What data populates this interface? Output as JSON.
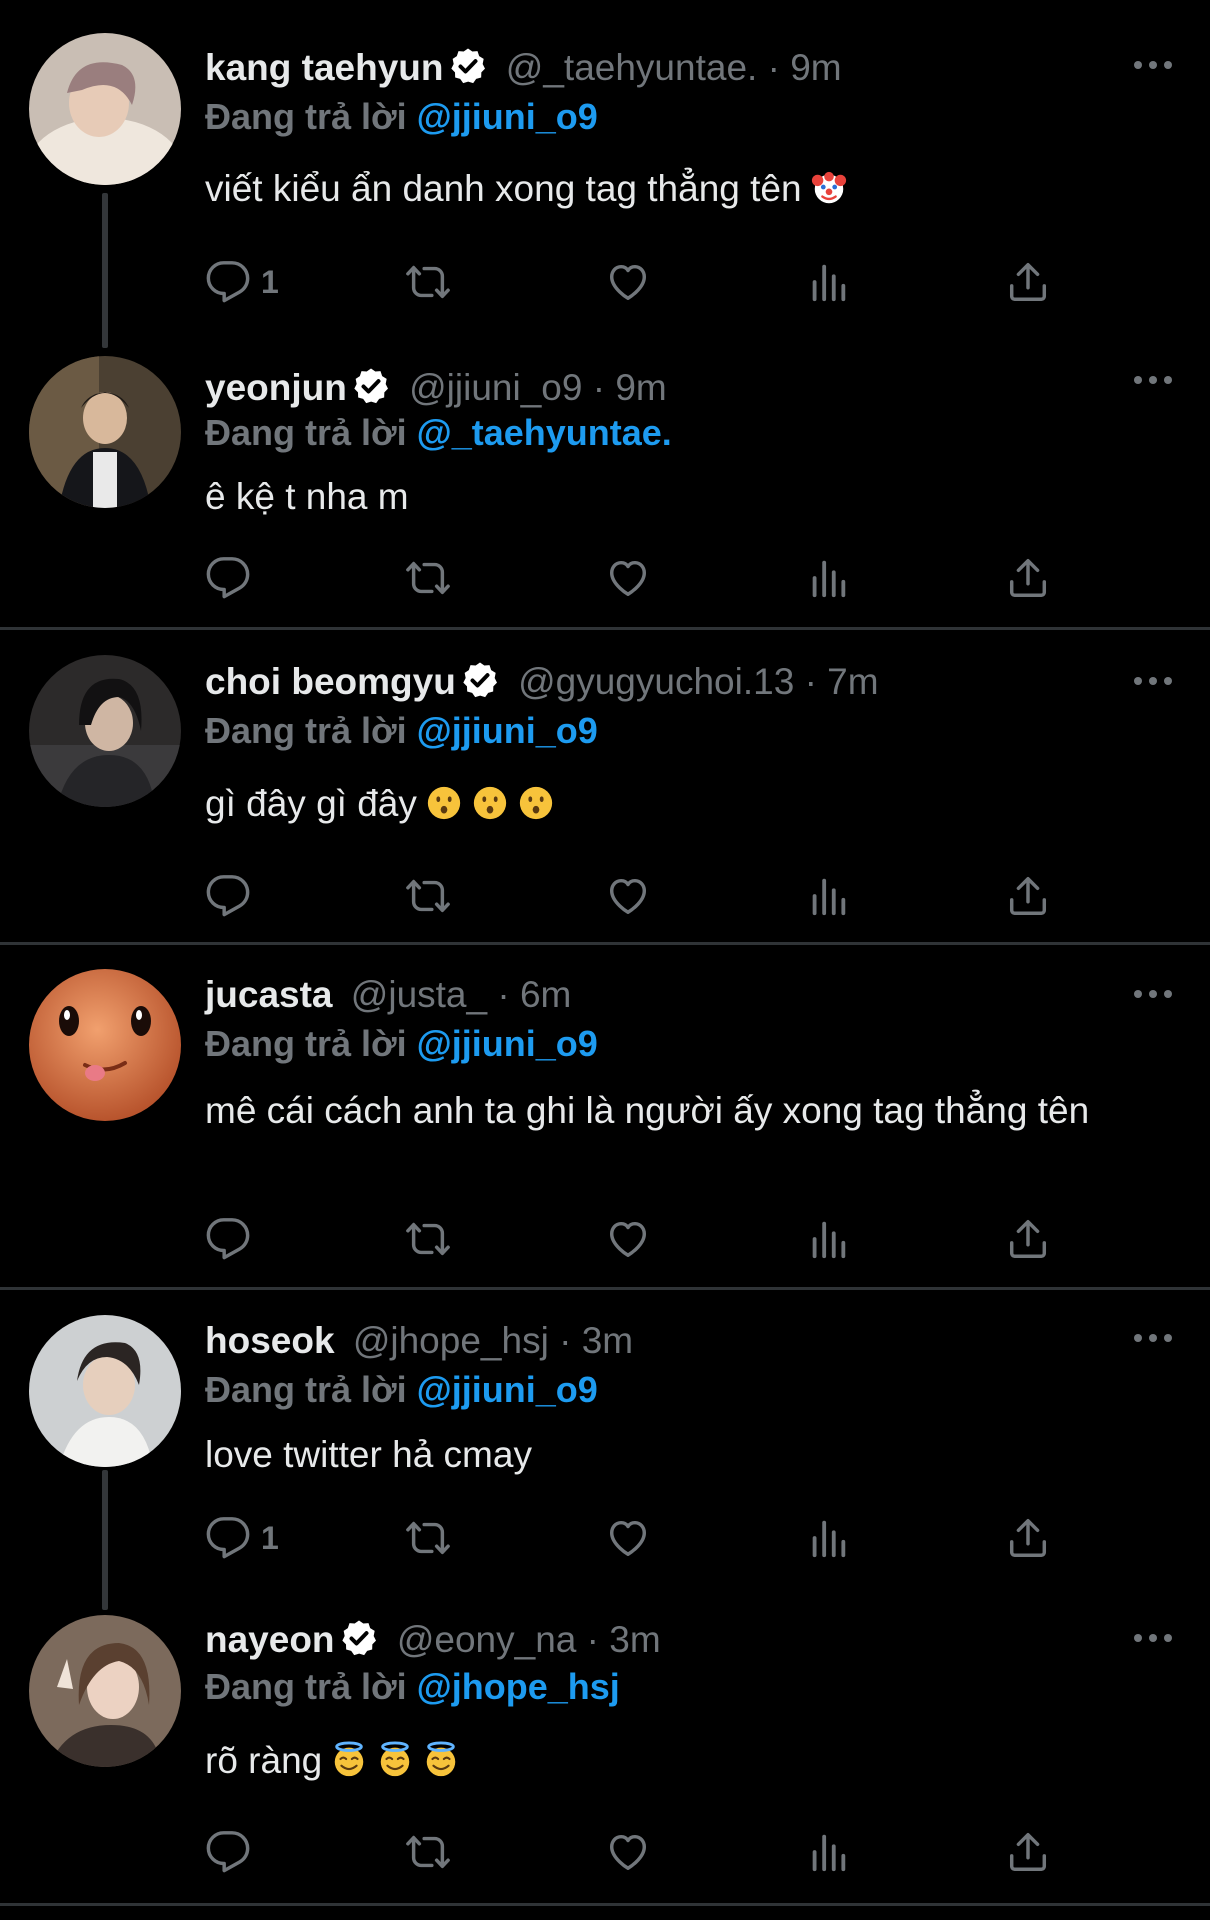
{
  "replying_prefix": "Đang trả lời",
  "colors": {
    "background": "#000000",
    "text": "#e7e9ea",
    "muted": "#71767b",
    "accent": "#1d9bf0",
    "divider": "#2f3336"
  },
  "tweets": [
    {
      "name": "kang taehyun",
      "verified": true,
      "handle": "@_taehyuntae.",
      "time": "9m",
      "replying_to": "@jjiuni_o9",
      "text": "viết kiểu ẩn danh xong tag thẳng tên",
      "emoji": [
        "clown-face"
      ],
      "reply_count": "1"
    },
    {
      "name": "yeonjun",
      "verified": true,
      "handle": "@jjiuni_o9",
      "time": "9m",
      "replying_to": "@_taehyuntae.",
      "text": "ê kệ t nha m",
      "emoji": [],
      "reply_count": ""
    },
    {
      "name": "choi beomgyu",
      "verified": true,
      "handle": "@gyugyuchoi.13",
      "time": "7m",
      "replying_to": "@jjiuni_o9",
      "text": "gì đây gì đây",
      "emoji": [
        "hushed-face",
        "hushed-face",
        "hushed-face"
      ],
      "reply_count": ""
    },
    {
      "name": "jucasta",
      "verified": false,
      "handle": "@justa_",
      "time": "6m",
      "replying_to": "@jjiuni_o9",
      "text": "mê cái cách anh ta ghi là người ấy xong tag thẳng tên",
      "emoji": [],
      "reply_count": ""
    },
    {
      "name": "hoseok",
      "verified": false,
      "handle": "@jhope_hsj",
      "time": "3m",
      "replying_to": "@jjiuni_o9",
      "text": "love twitter hả cmay",
      "emoji": [],
      "reply_count": "1"
    },
    {
      "name": "nayeon",
      "verified": true,
      "handle": "@eony_na",
      "time": "3m",
      "replying_to": "@jhope_hsj",
      "text": "rõ ràng",
      "emoji": [
        "smiling-face-with-halo",
        "smiling-face-with-halo",
        "smiling-face-with-halo"
      ],
      "reply_count": ""
    }
  ],
  "icons": {
    "reply": "reply-icon",
    "retweet": "retweet-icon",
    "like": "heart-icon",
    "views": "views-icon",
    "share": "share-icon",
    "more": "more-icon",
    "verified": "verified-badge-icon"
  }
}
